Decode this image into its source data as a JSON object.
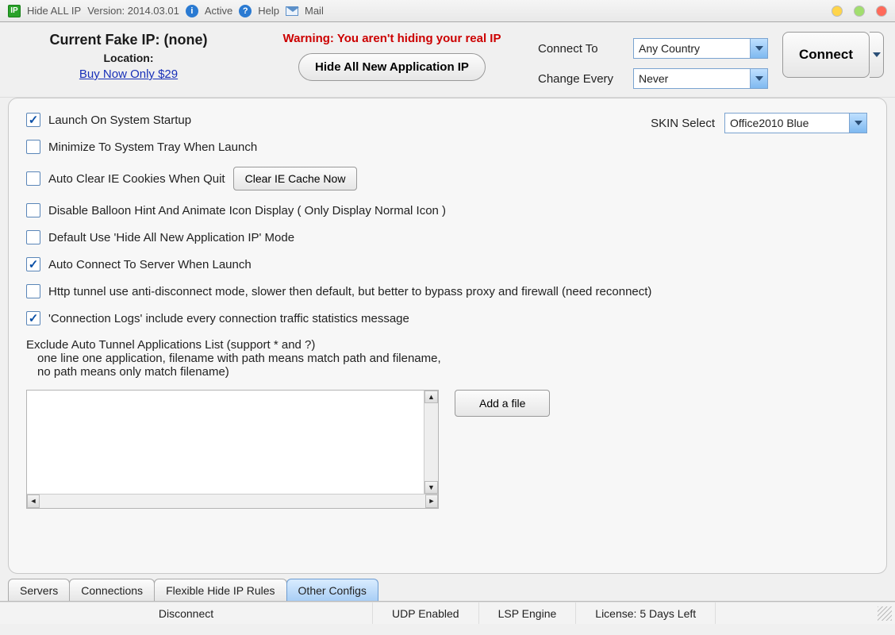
{
  "titlebar": {
    "app": "Hide ALL IP",
    "version_label": "Version: 2014.03.01",
    "status": "Active",
    "help": "Help",
    "mail": "Mail"
  },
  "header": {
    "ip_label": "Current Fake IP: (none)",
    "location_label": "Location:",
    "buy_link": "Buy Now Only $29",
    "warning": "Warning: You aren't hiding your real IP",
    "hide_button": "Hide All New Application IP",
    "connect_to_label": "Connect To",
    "connect_to_value": "Any Country",
    "change_every_label": "Change Every",
    "change_every_value": "Never",
    "connect_button": "Connect"
  },
  "settings": {
    "opt_launch_startup": "Launch On System Startup",
    "opt_min_tray": "Minimize To System Tray When Launch",
    "opt_clear_cookies": "Auto Clear IE Cookies When Quit",
    "clear_cache_btn": "Clear IE Cache Now",
    "opt_disable_balloon": "Disable Balloon Hint And Animate Icon Display ( Only Display Normal Icon )",
    "opt_default_hide": "Default Use 'Hide All New Application IP' Mode",
    "opt_auto_connect": "Auto Connect To Server When Launch",
    "opt_http_tunnel": "Http tunnel use anti-disconnect mode, slower then default, but better to bypass proxy and firewall (need reconnect)",
    "opt_conn_logs": "'Connection Logs' include every connection traffic statistics message",
    "skin_label": "SKIN Select",
    "skin_value": "Office2010 Blue",
    "exclude_title": "Exclude Auto Tunnel Applications List (support * and ?)",
    "exclude_line1": "one line one application, filename with path means match path and filename,",
    "exclude_line2": "no path means only match filename)",
    "add_file_btn": "Add a file",
    "checked": {
      "launch_startup": true,
      "min_tray": false,
      "clear_cookies": false,
      "disable_balloon": false,
      "default_hide": false,
      "auto_connect": true,
      "http_tunnel": false,
      "conn_logs": true
    }
  },
  "tabs": {
    "servers": "Servers",
    "connections": "Connections",
    "flexible": "Flexible Hide IP Rules",
    "other": "Other Configs"
  },
  "statusbar": {
    "disconnect": "Disconnect",
    "udp": "UDP Enabled",
    "lsp": "LSP Engine",
    "license": "License: 5 Days Left"
  }
}
